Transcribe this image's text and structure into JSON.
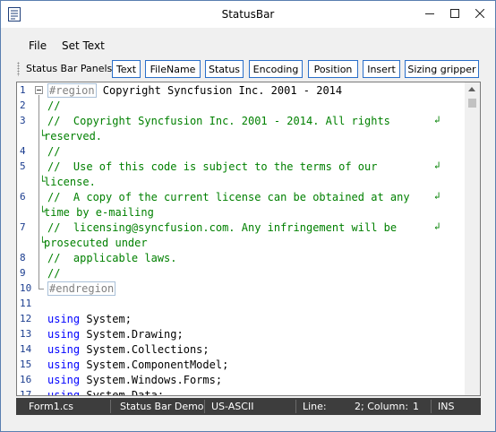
{
  "window": {
    "title": "StatusBar"
  },
  "menu": {
    "items": [
      "File",
      "Set Text"
    ]
  },
  "toolbar": {
    "label": "Status Bar Panels:",
    "buttons": [
      "Text",
      "FileName",
      "Status",
      "Encoding",
      "Position",
      "Insert",
      "Sizing gripper"
    ]
  },
  "editor": {
    "lines": [
      {
        "n": "1",
        "parts": [
          {
            "c": "region",
            "t": "#region"
          },
          {
            "c": "",
            "t": " Copyright Syncfusion Inc. 2001 - 2014"
          }
        ]
      },
      {
        "n": "2",
        "parts": [
          {
            "c": "cm",
            "t": "//"
          }
        ]
      },
      {
        "n": "3",
        "parts": [
          {
            "c": "cm",
            "t": "//  Copyright Syncfusion Inc. 2001 - 2014. All rights"
          }
        ]
      },
      {
        "n": "",
        "parts": [
          {
            "c": "cm",
            "t": "reserved."
          }
        ]
      },
      {
        "n": "4",
        "parts": [
          {
            "c": "cm",
            "t": "//"
          }
        ]
      },
      {
        "n": "5",
        "parts": [
          {
            "c": "cm",
            "t": "//  Use of this code is subject to the terms of our"
          }
        ]
      },
      {
        "n": "",
        "parts": [
          {
            "c": "cm",
            "t": "license."
          }
        ]
      },
      {
        "n": "6",
        "parts": [
          {
            "c": "cm",
            "t": "//  A copy of the current license can be obtained at any"
          }
        ]
      },
      {
        "n": "",
        "parts": [
          {
            "c": "cm",
            "t": "time by e-mailing"
          }
        ]
      },
      {
        "n": "7",
        "parts": [
          {
            "c": "cm",
            "t": "//  licensing@syncfusion.com. Any infringement will be"
          }
        ]
      },
      {
        "n": "",
        "parts": [
          {
            "c": "cm",
            "t": "prosecuted under"
          }
        ]
      },
      {
        "n": "8",
        "parts": [
          {
            "c": "cm",
            "t": "//  applicable laws."
          }
        ]
      },
      {
        "n": "9",
        "parts": [
          {
            "c": "cm",
            "t": "//"
          }
        ]
      },
      {
        "n": "10",
        "parts": [
          {
            "c": "region",
            "t": "#endregion"
          }
        ]
      },
      {
        "n": "11",
        "parts": []
      },
      {
        "n": "12",
        "parts": [
          {
            "c": "kw",
            "t": "using"
          },
          {
            "c": "",
            "t": " System;"
          }
        ]
      },
      {
        "n": "13",
        "parts": [
          {
            "c": "kw",
            "t": "using"
          },
          {
            "c": "",
            "t": " System.Drawing;"
          }
        ]
      },
      {
        "n": "14",
        "parts": [
          {
            "c": "kw",
            "t": "using"
          },
          {
            "c": "",
            "t": " System.Collections;"
          }
        ]
      },
      {
        "n": "15",
        "parts": [
          {
            "c": "kw",
            "t": "using"
          },
          {
            "c": "",
            "t": " System.ComponentModel;"
          }
        ]
      },
      {
        "n": "16",
        "parts": [
          {
            "c": "kw",
            "t": "using"
          },
          {
            "c": "",
            "t": " System.Windows.Forms;"
          }
        ]
      },
      {
        "n": "17",
        "parts": [
          {
            "c": "kw",
            "t": "using"
          },
          {
            "c": "",
            "t": " System.Data;"
          }
        ]
      }
    ]
  },
  "statusbar": {
    "filename": "Form1.cs",
    "text": "Status Bar Demo",
    "encoding": "US-ASCII",
    "line_label": "Line:",
    "column_label": "2; Column:",
    "column_value": "1",
    "insert": "INS"
  },
  "icons": {
    "app": "app-document-icon",
    "minimize": "minimize-icon",
    "maximize": "maximize-icon",
    "close": "close-icon",
    "wrap": "word-wrap-icon",
    "fold": "collapse-icon"
  }
}
